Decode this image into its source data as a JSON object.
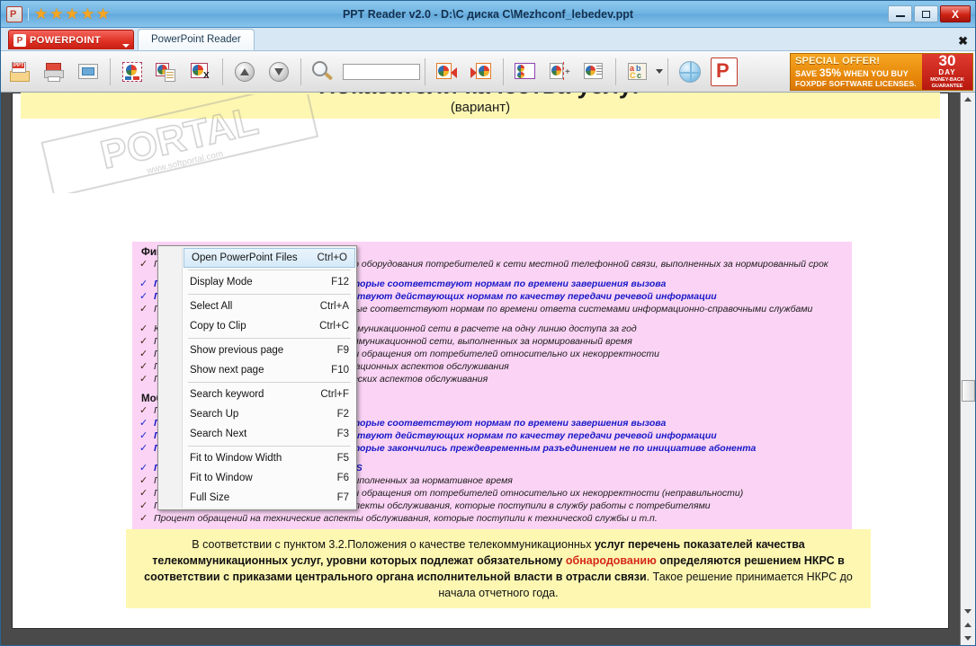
{
  "window": {
    "title": "PPT Reader v2.0 - D:\\C диска C\\Mezhconf_lebedev.ppt",
    "app_icon": "powerpoint-icon",
    "stars": [
      "★",
      "★",
      "★",
      "★",
      "★"
    ],
    "minimize_label": "",
    "maximize_label": "",
    "close_label": "X"
  },
  "tabs": {
    "brand_label": "POWERPOINT",
    "doc_tab_label": "PowerPoint Reader",
    "close_label": "✖"
  },
  "toolbar": {
    "search_value": "",
    "search_placeholder": "",
    "buttons": [
      {
        "name": "open-ppt-file",
        "title": "Open PowerPoint Files"
      },
      {
        "name": "print",
        "title": "Print"
      },
      {
        "name": "display-mode",
        "title": "Display Mode"
      },
      {
        "name": "select-all",
        "title": "Select All"
      },
      {
        "name": "copy-to-clip",
        "title": "Copy to Clip"
      },
      {
        "name": "copy-text",
        "title": "Copy Text"
      },
      {
        "name": "previous-page",
        "title": "Show previous page"
      },
      {
        "name": "next-page",
        "title": "Show next page"
      },
      {
        "name": "search",
        "title": "Search keyword"
      },
      {
        "name": "search-up",
        "title": "Search Up"
      },
      {
        "name": "search-next",
        "title": "Search Next"
      },
      {
        "name": "fit-window-width",
        "title": "Fit to Window Width"
      },
      {
        "name": "fit-window",
        "title": "Fit to Window"
      },
      {
        "name": "full-size",
        "title": "Full Size"
      },
      {
        "name": "language",
        "title": "Language"
      },
      {
        "name": "website",
        "title": "Website"
      },
      {
        "name": "about",
        "title": "About"
      }
    ]
  },
  "ad": {
    "line1": "SPECIAL OFFER!",
    "line2_pre": "SAVE ",
    "line2_pct": "35%",
    "line2_post": " WHEN YOU BUY",
    "line3": "FOXPDF SOFTWARE LICENSES.",
    "badge_number": "30",
    "badge_day": "DAY",
    "badge_guarantee": "MONEY-BACK GUARANTEE"
  },
  "context_menu": {
    "groups": [
      [
        {
          "label": "Open PowerPoint Files",
          "accel": "Ctrl+O",
          "highlighted": true
        }
      ],
      [
        {
          "label": "Display Mode",
          "accel": "F12",
          "highlighted": false
        }
      ],
      [
        {
          "label": "Select All",
          "accel": "Ctrl+A",
          "highlighted": false
        },
        {
          "label": "Copy to Clip",
          "accel": "Ctrl+C",
          "highlighted": false
        }
      ],
      [
        {
          "label": "Show previous page",
          "accel": "F9",
          "highlighted": false
        },
        {
          "label": "Show next page",
          "accel": "F10",
          "highlighted": false
        }
      ],
      [
        {
          "label": "Search keyword",
          "accel": "Ctrl+F",
          "highlighted": false
        },
        {
          "label": "Search Up",
          "accel": "F2",
          "highlighted": false
        },
        {
          "label": "Search Next",
          "accel": "F3",
          "highlighted": false
        }
      ],
      [
        {
          "label": "Fit to Window Width",
          "accel": "F5",
          "highlighted": false
        },
        {
          "label": "Fit to Window",
          "accel": "F6",
          "highlighted": false
        },
        {
          "label": "Full Size",
          "accel": "F7",
          "highlighted": false
        }
      ]
    ]
  },
  "slide": {
    "title": "Показатели качества услуг",
    "subtitle": "(вариант)",
    "section1_heading": "Фиксированная телефонная связь",
    "section1_items": [
      {
        "text": "Процент заявлений о подключении конечного оборудования потребителей к сети местной телефонной связи, выполненных за нормированный срок",
        "blue": false,
        "gap": false
      },
      {
        "text": "Процент установленных соединений, которые соответствуют нормам по времени завершения вызова",
        "blue": true,
        "gap": true
      },
      {
        "text": "Процент соединений, которые соответствуют действующих нормам по качеству передачи речевой информации",
        "blue": true,
        "gap": false
      },
      {
        "text": "Процент установленных соединений, которые соответствуют нормам по времени ответа системами информационно-справочными службами",
        "blue": false,
        "gap": false
      },
      {
        "text": "Количество повреждений на линиях телекоммуникационной сети в расчете на одну линию доступа за год",
        "blue": false,
        "gap": true
      },
      {
        "text": "Процент заявлений о повреждениях телекоммуникационной сети, выполненных за нормированный время",
        "blue": false,
        "gap": false
      },
      {
        "text": "Процент счетов, на которые были получены обращения от потребителей относительно их некорректности",
        "blue": false,
        "gap": false
      },
      {
        "text": "Процент обращений относительно организационных аспектов обслуживания",
        "blue": false,
        "gap": false
      },
      {
        "text": "Процент обращений относительно технических аспектов обслуживания",
        "blue": false,
        "gap": false
      }
    ],
    "section2_heading": "Мобильная связь",
    "section2_items": [
      {
        "text": "Процент неуспешных вызовов",
        "blue": false,
        "gap": false
      },
      {
        "text": "Процент установленных соединений, которые соответствуют нормам по времени завершения вызова",
        "blue": true,
        "gap": false
      },
      {
        "text": "Процент соединений, которые соответствуют действующих нормам по качеству передачи речевой информации",
        "blue": true,
        "gap": false
      },
      {
        "text": "Процент установленных соединений, которые закончились преждевременным разъединением не по инициативе абонента",
        "blue": true,
        "gap": false
      },
      {
        "text": "Процент недоставленных сообщений SMS",
        "blue": true,
        "gap": true
      },
      {
        "text": "Процент заявлений о повреждениях сети, выполненных за нормативное время",
        "blue": false,
        "gap": false
      },
      {
        "text": "Процент счетов, на которые были получены обращения от потребителей относительно их некорректности (неправильности)",
        "blue": false,
        "gap": false
      },
      {
        "text": "Процент обращений на организационные аспекты обслуживания, которые поступили в службу работы с потребителями",
        "blue": false,
        "gap": false
      },
      {
        "text": "Процент обращений на технические аспекты обслуживания, которые поступили к технической службы и т.п.",
        "blue": false,
        "gap": false
      }
    ],
    "footer_note": {
      "p1": "В соответствии с пунктом 3.2.Положения о качестве телекоммуникационньх ",
      "b1": "услуг перечень показателей качества телекоммуникационных услуг, уровни которых подлежат обязательному ",
      "red": "обнародованию",
      "b2": " определяются решением НКРС в соответствии с приказами центрального органа исполнительной власти в отрасли связи",
      "p2": ". Такое  решение принимается НКРС до начала отчетного года."
    },
    "checkmark": "✓"
  },
  "scrollbar": {
    "up_arrow": "▲",
    "down_arrow": "▼"
  },
  "watermark": {
    "text": "PORTAL",
    "sub": "www.softportal.com"
  },
  "colors": {
    "title_bar": "#6fb4e2",
    "brand_red": "#df2e21",
    "slide_yellow": "#fdf7b2",
    "slide_pink": "#fbd4f5",
    "accent_blue_text": "#1718c8",
    "accent_red_text": "#d42a1a",
    "ad_orange": "#e8890a"
  }
}
